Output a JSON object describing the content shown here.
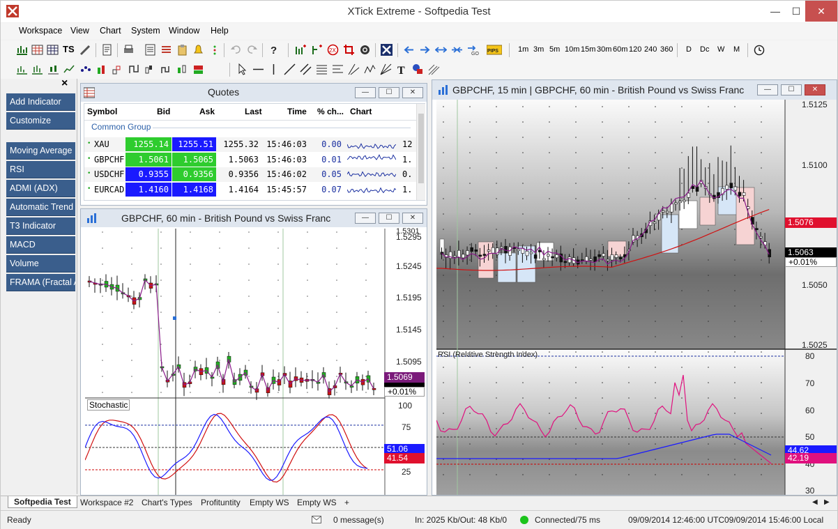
{
  "window": {
    "title": "XTick Extreme - Softpedia Test",
    "minimize": "—",
    "maximize": "☐",
    "close": "✕"
  },
  "menu": [
    "Workspace",
    "View",
    "Chart",
    "System",
    "Window",
    "Help"
  ],
  "toolbar": {
    "periods": [
      "1m",
      "3m",
      "5m",
      "10m",
      "15m",
      "30m",
      "60m",
      "120",
      "240",
      "360"
    ],
    "ranges": [
      "D",
      "Dc",
      "W",
      "M"
    ],
    "ts": "TS",
    "pips": "PIPS"
  },
  "left_panel": {
    "close": "×",
    "items": [
      "Add Indicator",
      "Customize",
      "Moving Average",
      "RSI",
      "ADMI (ADX)",
      "Automatic Trend",
      "T3 Indicator",
      "MACD",
      "Volume",
      "FRAMA (Fractal A"
    ]
  },
  "quotes": {
    "title": "Quotes",
    "columns": [
      "Symbol",
      "Bid",
      "Ask",
      "Last",
      "Time",
      "% ch...",
      "Chart"
    ],
    "group": "Common Group",
    "rows": [
      {
        "symbol": "XAU",
        "bid": "1255.14",
        "ask": "1255.51",
        "last": "1255.32",
        "time": "15:46:03",
        "pct": "0.00",
        "extra": "12",
        "bid_color": "#2ecc2e",
        "ask_color": "#1a1aff"
      },
      {
        "symbol": "GBPCHF",
        "bid": "1.5061",
        "ask": "1.5065",
        "last": "1.5063",
        "time": "15:46:03",
        "pct": "0.01",
        "extra": "1.",
        "bid_color": "#2ecc2e",
        "ask_color": "#2ecc2e"
      },
      {
        "symbol": "USDCHF",
        "bid": "0.9355",
        "ask": "0.9356",
        "last": "0.9356",
        "time": "15:46:02",
        "pct": "0.05",
        "extra": "0.",
        "bid_color": "#1a1aff",
        "ask_color": "#2ecc2e"
      },
      {
        "symbol": "EURCAD",
        "bid": "1.4160",
        "ask": "1.4168",
        "last": "1.4164",
        "time": "15:45:57",
        "pct": "0.07",
        "extra": "1.",
        "bid_color": "#1a1aff",
        "ask_color": "#1a1aff"
      }
    ]
  },
  "chart60": {
    "title": "GBPCHF, 60 min - British Pound vs Swiss Franc",
    "y_ticks": [
      "1.5301",
      "1.5295",
      "1.5245",
      "1.5195",
      "1.5145",
      "1.5095"
    ],
    "last_price": "1.5069",
    "last_change": "+0.01%",
    "stoch_label": "Stochastic",
    "stoch_ticks": [
      "100",
      "75",
      "50",
      "25"
    ],
    "stoch_k": "51.06",
    "stoch_d": "41.54"
  },
  "chart15": {
    "title": "GBPCHF, 15 min | GBPCHF, 60 min - British Pound vs Swiss Franc",
    "y_ticks": [
      "1.5125",
      "1.5100",
      "1.5050",
      "1.5025"
    ],
    "ma_price": "1.5076",
    "last_price": "1.5063",
    "last_change": "+0.01%",
    "rsi_label": "RSI (Relative Strength Index)",
    "rsi_ticks": [
      "80",
      "70",
      "60",
      "50",
      "40",
      "30"
    ],
    "rsi_a": "44.62",
    "rsi_b": "42.19"
  },
  "tabs": [
    "Softpedia Test",
    "Workspace #2",
    "Chart's Types",
    "Profituntity",
    "Empty WS",
    "Empty WS",
    "+"
  ],
  "status": {
    "ready": "Ready",
    "messages": "0 message(s)",
    "traffic": "In: 2025 Kb/Out: 48 Kb/0",
    "connection": "Connected/75 ms",
    "utc": "09/09/2014 12:46:00 UTC",
    "local": "09/09/2014 15:46:00 Local"
  }
}
